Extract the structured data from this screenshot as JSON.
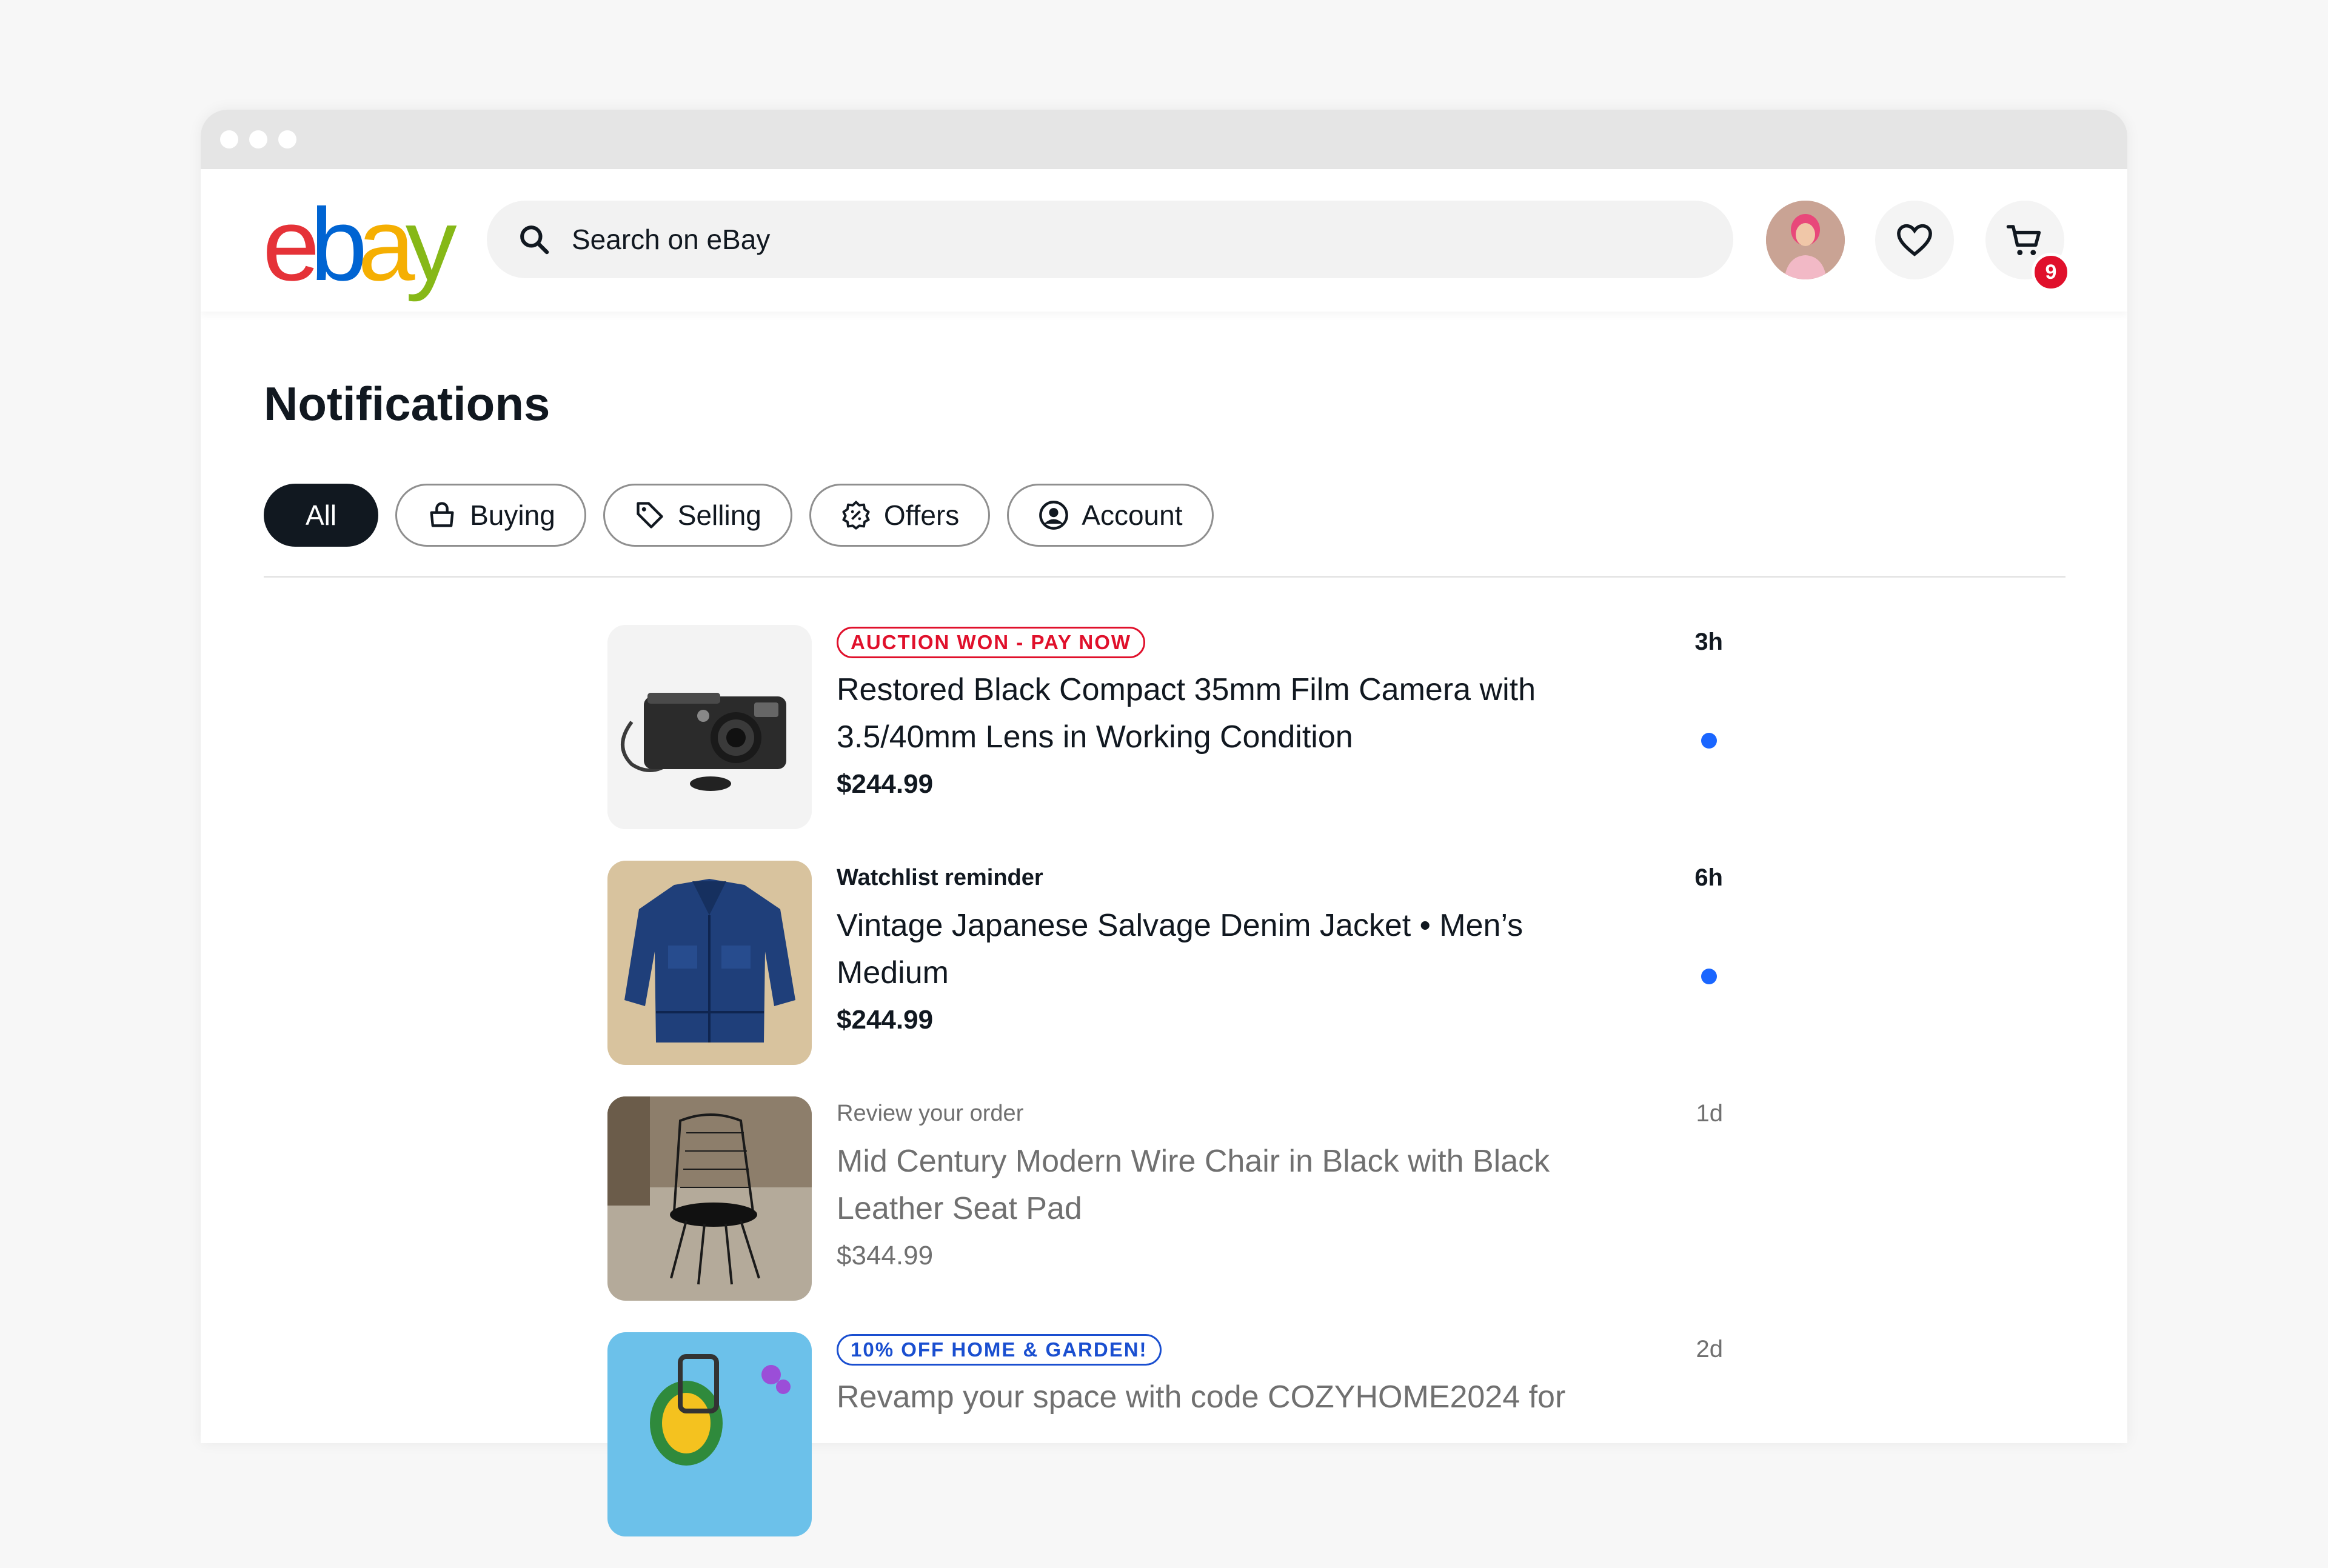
{
  "header": {
    "logo_letters": [
      "e",
      "b",
      "a",
      "y"
    ],
    "logo_colors": [
      "#e53238",
      "#0064d2",
      "#f5af02",
      "#86b817"
    ],
    "search_placeholder": "Search on eBay",
    "cart_count": "9"
  },
  "page_title": "Notifications",
  "filters": [
    {
      "label": "All",
      "icon": "none",
      "active": true
    },
    {
      "label": "Buying",
      "icon": "shopping-bag-icon"
    },
    {
      "label": "Selling",
      "icon": "tag-icon"
    },
    {
      "label": "Offers",
      "icon": "offer-badge-icon"
    },
    {
      "label": "Account",
      "icon": "user-circle-icon"
    }
  ],
  "notifications": [
    {
      "eyebrow": "AUCTION WON - PAY NOW",
      "title_line1": "Restored Black Compact 35mm Film Camera with",
      "title_line2": "3.5/40mm Lens in Working Condition",
      "price": "$244.99",
      "time": "3h",
      "unread": true
    },
    {
      "eyebrow": "Watchlist reminder",
      "title_line1": "Vintage Japanese Salvage Denim Jacket • Men’s",
      "title_line2": "Medium",
      "price": "$244.99",
      "time": "6h",
      "unread": true
    },
    {
      "eyebrow": "Review your order",
      "title_line1": "Mid Century Modern Wire Chair in Black  with Black",
      "title_line2": "Leather Seat Pad",
      "price": "$344.99",
      "time": "1d",
      "unread": false
    },
    {
      "eyebrow": "10% OFF HOME & GARDEN!",
      "title_line1": "Revamp your space with code COZYHOME2024 for",
      "time": "2d",
      "unread": false
    }
  ],
  "colors": {
    "accent_red": "#e0102b",
    "accent_blue": "#1a4fd0",
    "unread_dot": "#1a66ff"
  }
}
